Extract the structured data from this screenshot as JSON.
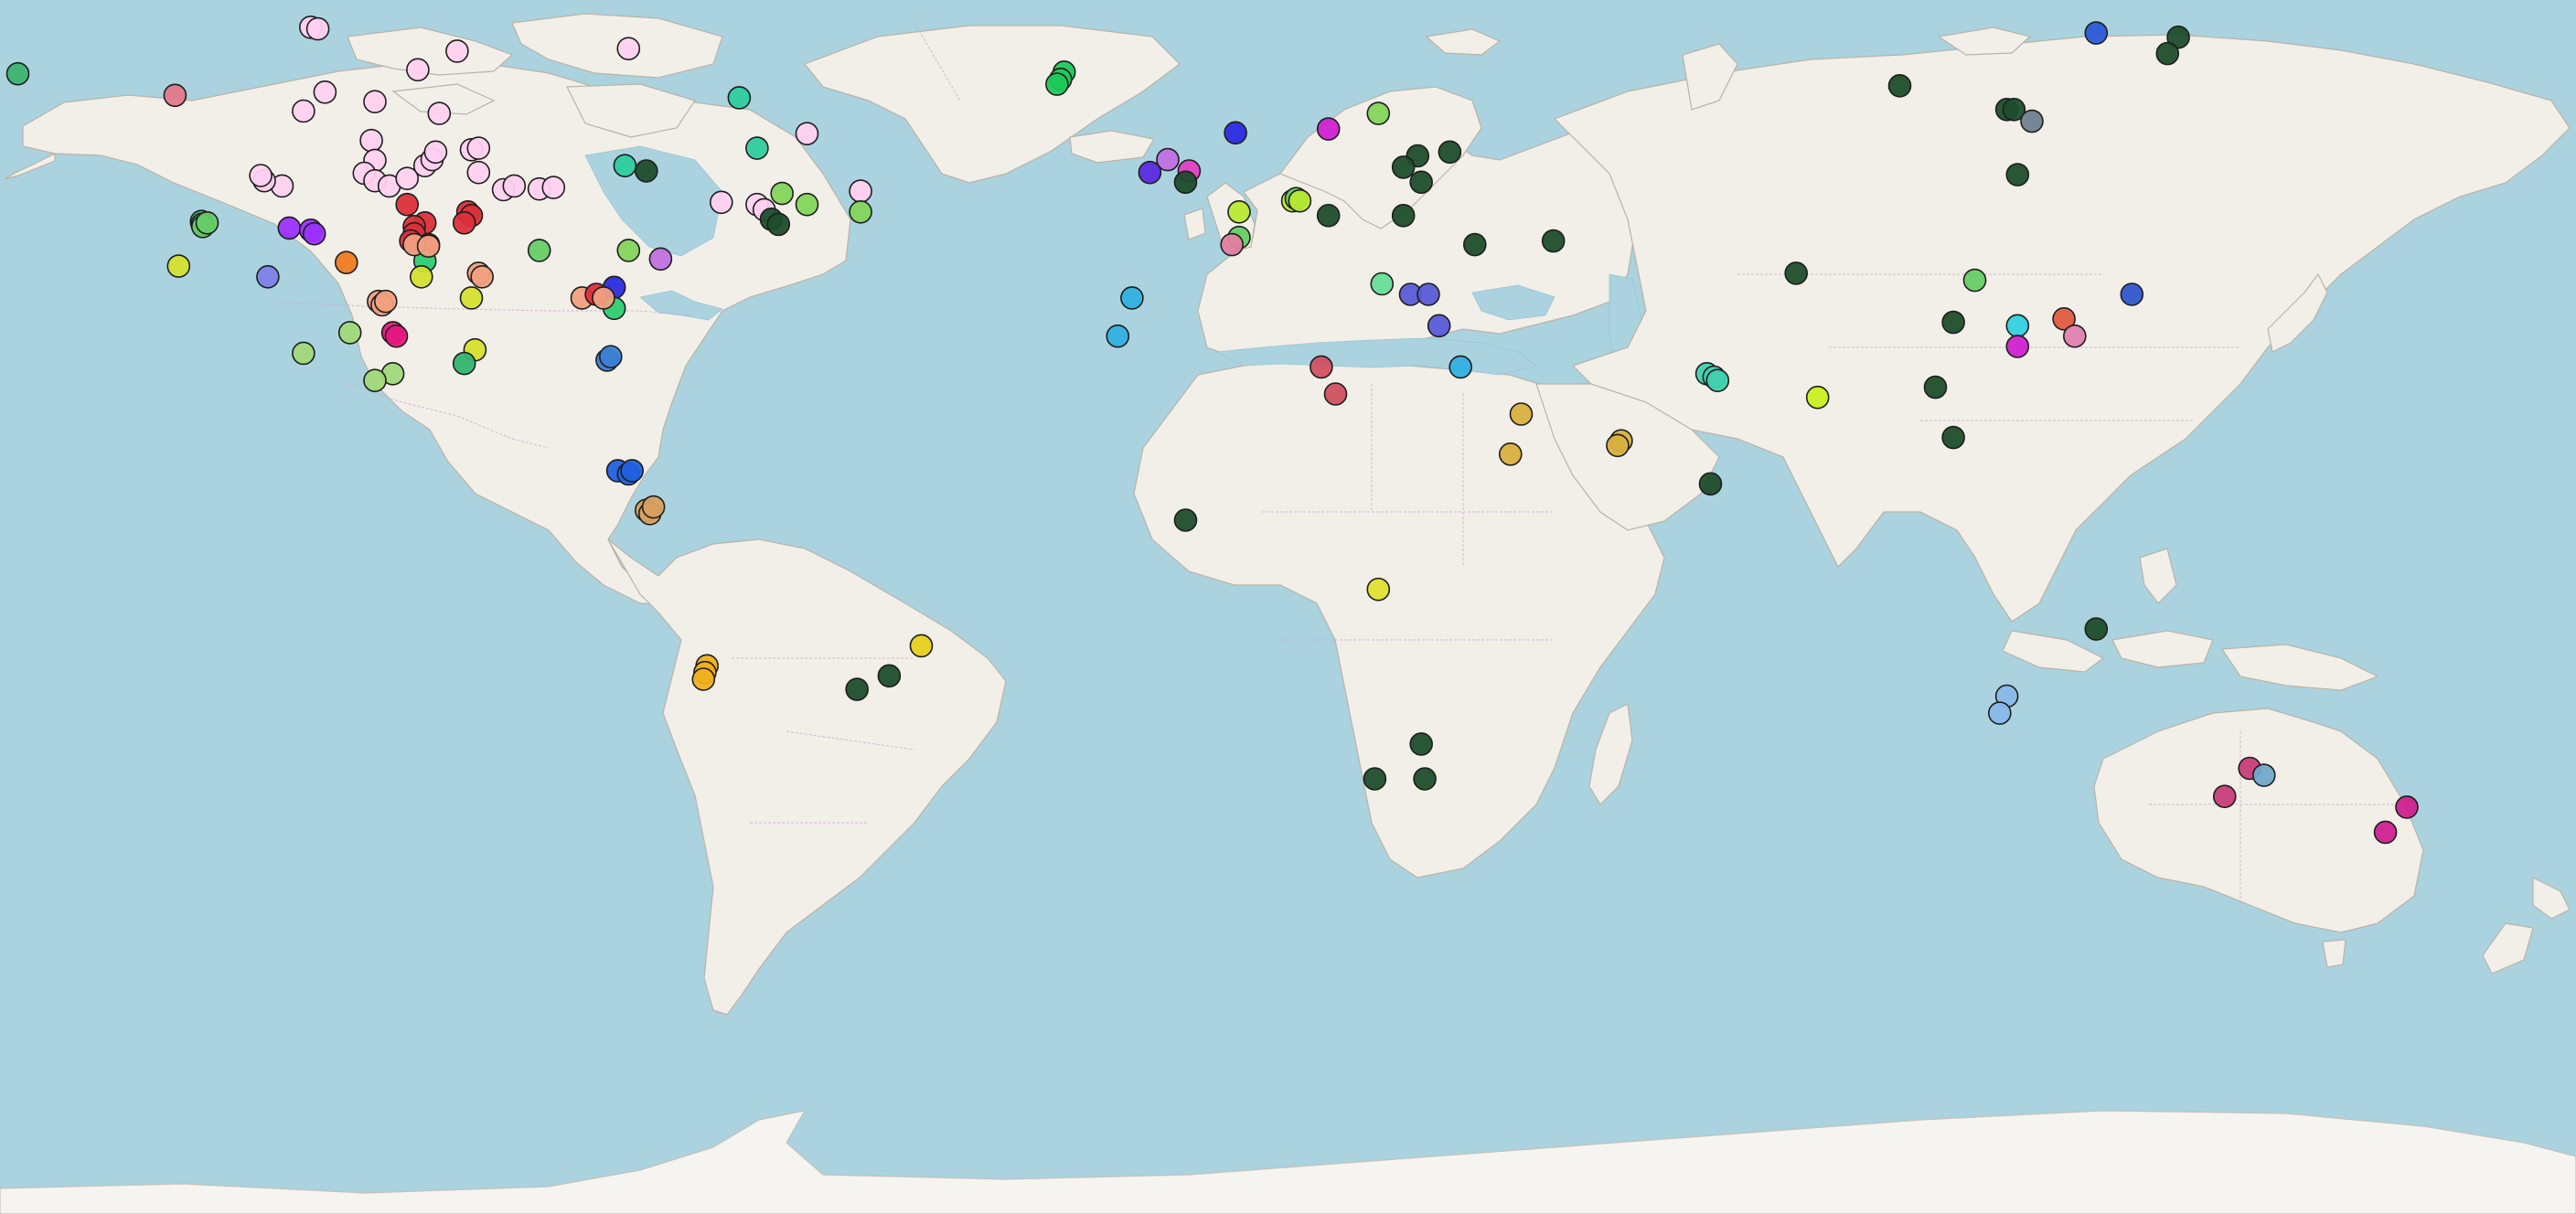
{
  "map": {
    "marker_count": 177
  },
  "markers": [
    {
      "lon": -166.0,
      "lat": 65.5,
      "color": "#3cb371"
    },
    {
      "lon": -144.0,
      "lat": 62.8,
      "color": "#e0788a"
    },
    {
      "lon": -109.0,
      "lat": 78.8,
      "color": "#ffd0f0"
    },
    {
      "lon": -94.5,
      "lat": 78.5,
      "color": "#ffd0f0"
    },
    {
      "lon": -83.5,
      "lat": 76.2,
      "color": "#ffd0f0"
    },
    {
      "lon": -125.0,
      "lat": 71.2,
      "color": "#ffd0f0"
    },
    {
      "lon": -124.0,
      "lat": 71.0,
      "color": "#ffd0f0"
    },
    {
      "lon": -110.0,
      "lat": 66.0,
      "color": "#ffd0f0"
    },
    {
      "lon": -123.0,
      "lat": 63.2,
      "color": "#ffd0f0"
    },
    {
      "lon": -126.0,
      "lat": 60.8,
      "color": "#ffd0f0"
    },
    {
      "lon": -116.0,
      "lat": 62.0,
      "color": "#ffd0f0"
    },
    {
      "lon": -107.0,
      "lat": 60.5,
      "color": "#ffd0f0"
    },
    {
      "lon": -116.5,
      "lat": 57.0,
      "color": "#ffd0f0"
    },
    {
      "lon": -116.0,
      "lat": 54.4,
      "color": "#ffd0f0"
    },
    {
      "lon": -117.5,
      "lat": 52.7,
      "color": "#ffd0f0"
    },
    {
      "lon": -116.0,
      "lat": 51.7,
      "color": "#ffd0f0"
    },
    {
      "lon": -114.0,
      "lat": 51.0,
      "color": "#ffd0f0"
    },
    {
      "lon": -111.5,
      "lat": 52.0,
      "color": "#ffd0f0"
    },
    {
      "lon": -109.0,
      "lat": 53.7,
      "color": "#ffd0f0"
    },
    {
      "lon": -108.0,
      "lat": 54.5,
      "color": "#ffd0f0"
    },
    {
      "lon": -107.5,
      "lat": 55.5,
      "color": "#ffd0f0"
    },
    {
      "lon": -102.5,
      "lat": 55.8,
      "color": "#ffd0f0"
    },
    {
      "lon": -101.5,
      "lat": 56.0,
      "color": "#ffd0f0"
    },
    {
      "lon": -101.5,
      "lat": 52.8,
      "color": "#ffd0f0"
    },
    {
      "lon": -98.0,
      "lat": 50.5,
      "color": "#ffd0f0"
    },
    {
      "lon": -96.5,
      "lat": 51.0,
      "color": "#ffd0f0"
    },
    {
      "lon": -93.0,
      "lat": 50.6,
      "color": "#ffd0f0"
    },
    {
      "lon": -91.0,
      "lat": 50.8,
      "color": "#ffd0f0"
    },
    {
      "lon": -129.0,
      "lat": 51.0,
      "color": "#ffd0f0"
    },
    {
      "lon": -131.5,
      "lat": 51.7,
      "color": "#ffd0f0"
    },
    {
      "lon": -132.0,
      "lat": 52.4,
      "color": "#ffd0f0"
    },
    {
      "lon": -104.5,
      "lat": 68.3,
      "color": "#ffd0f0"
    },
    {
      "lon": -80.5,
      "lat": 68.6,
      "color": "#ffd0f0"
    },
    {
      "lon": -55.5,
      "lat": 57.9,
      "color": "#ffd0f0"
    },
    {
      "lon": -48.0,
      "lat": 50.3,
      "color": "#ffd0f0"
    },
    {
      "lon": -67.5,
      "lat": 48.8,
      "color": "#ffd0f0"
    },
    {
      "lon": -62.5,
      "lat": 48.5,
      "color": "#ffd0f0"
    },
    {
      "lon": -61.5,
      "lat": 47.8,
      "color": "#ffd0f0"
    },
    {
      "lon": -81.0,
      "lat": 53.7,
      "color": "#2ecc9e"
    },
    {
      "lon": -78.0,
      "lat": 53.0,
      "color": "#1e4d2b"
    },
    {
      "lon": -62.5,
      "lat": 56.0,
      "color": "#2ecc9e"
    },
    {
      "lon": -65.0,
      "lat": 62.5,
      "color": "#2ecc9e"
    },
    {
      "lon": -59.0,
      "lat": 50.0,
      "color": "#84d45c"
    },
    {
      "lon": -55.5,
      "lat": 48.5,
      "color": "#84d45c"
    },
    {
      "lon": -48.0,
      "lat": 47.5,
      "color": "#84d45c"
    },
    {
      "lon": -60.5,
      "lat": 46.5,
      "color": "#1e4d2b"
    },
    {
      "lon": -59.5,
      "lat": 45.8,
      "color": "#1e4d2b"
    },
    {
      "lon": -80.5,
      "lat": 42.2,
      "color": "#84d45c"
    },
    {
      "lon": -140.3,
      "lat": 46.2,
      "color": "#3cb371"
    },
    {
      "lon": -140.2,
      "lat": 45.8,
      "color": "#3cb371"
    },
    {
      "lon": -140.1,
      "lat": 45.5,
      "color": "#66cc66"
    },
    {
      "lon": -139.5,
      "lat": 46.0,
      "color": "#66cc66"
    },
    {
      "lon": -143.5,
      "lat": 40.0,
      "color": "#d4e030"
    },
    {
      "lon": -128.0,
      "lat": 45.3,
      "color": "#9b30ff"
    },
    {
      "lon": -125.0,
      "lat": 45.0,
      "color": "#9b30ff"
    },
    {
      "lon": -124.5,
      "lat": 44.5,
      "color": "#9b30ff"
    },
    {
      "lon": -131.0,
      "lat": 38.5,
      "color": "#8080e8"
    },
    {
      "lon": -120.0,
      "lat": 40.5,
      "color": "#f07a20"
    },
    {
      "lon": -111.5,
      "lat": 48.5,
      "color": "#dc2f3a"
    },
    {
      "lon": -109.0,
      "lat": 46.0,
      "color": "#dc2f3a"
    },
    {
      "lon": -110.5,
      "lat": 45.5,
      "color": "#dc2f3a"
    },
    {
      "lon": -110.5,
      "lat": 44.5,
      "color": "#dc2f3a"
    },
    {
      "lon": -111.0,
      "lat": 43.5,
      "color": "#dc2f3a"
    },
    {
      "lon": -108.5,
      "lat": 43.0,
      "color": "#dc2f3a"
    },
    {
      "lon": -103.0,
      "lat": 47.5,
      "color": "#dc2f3a"
    },
    {
      "lon": -102.5,
      "lat": 47.0,
      "color": "#dc2f3a"
    },
    {
      "lon": -103.5,
      "lat": 46.0,
      "color": "#dc2f3a"
    },
    {
      "lon": -109.0,
      "lat": 40.7,
      "color": "#2ecc71"
    },
    {
      "lon": -110.5,
      "lat": 43.0,
      "color": "#f0a080"
    },
    {
      "lon": -108.5,
      "lat": 42.8,
      "color": "#f0a080"
    },
    {
      "lon": -109.5,
      "lat": 38.5,
      "color": "#d4e030"
    },
    {
      "lon": -101.5,
      "lat": 39.0,
      "color": "#f0a080"
    },
    {
      "lon": -101.0,
      "lat": 38.5,
      "color": "#f0a080"
    },
    {
      "lon": -115.5,
      "lat": 35.0,
      "color": "#f0a080"
    },
    {
      "lon": -115.0,
      "lat": 34.5,
      "color": "#f0a080"
    },
    {
      "lon": -114.5,
      "lat": 35.0,
      "color": "#f0a080"
    },
    {
      "lon": -102.5,
      "lat": 35.5,
      "color": "#d4e030"
    },
    {
      "lon": -113.5,
      "lat": 30.5,
      "color": "#e6177f"
    },
    {
      "lon": -113.0,
      "lat": 30.0,
      "color": "#e6177f"
    },
    {
      "lon": -119.5,
      "lat": 30.5,
      "color": "#a0d87a"
    },
    {
      "lon": -102.0,
      "lat": 28.0,
      "color": "#d4e030"
    },
    {
      "lon": -126.0,
      "lat": 27.5,
      "color": "#a0d87a"
    },
    {
      "lon": -113.5,
      "lat": 24.5,
      "color": "#a0d87a"
    },
    {
      "lon": -116.0,
      "lat": 23.5,
      "color": "#a0d87a"
    },
    {
      "lon": -103.5,
      "lat": 26.0,
      "color": "#32b46e"
    },
    {
      "lon": -93.0,
      "lat": 42.2,
      "color": "#66cc66"
    },
    {
      "lon": -87.0,
      "lat": 35.5,
      "color": "#f0a080"
    },
    {
      "lon": -85.0,
      "lat": 36.0,
      "color": "#dc2f3a"
    },
    {
      "lon": -82.5,
      "lat": 37.0,
      "color": "#2b2be0"
    },
    {
      "lon": -82.5,
      "lat": 34.0,
      "color": "#2ecc71"
    },
    {
      "lon": -84.0,
      "lat": 35.5,
      "color": "#f0a080"
    },
    {
      "lon": -76.0,
      "lat": 41.0,
      "color": "#c070e0"
    },
    {
      "lon": -83.5,
      "lat": 26.5,
      "color": "#3a7fd5"
    },
    {
      "lon": -83.0,
      "lat": 27.0,
      "color": "#3a7fd5"
    },
    {
      "lon": -82.0,
      "lat": 10.0,
      "color": "#2060e0"
    },
    {
      "lon": -80.5,
      "lat": 9.5,
      "color": "#2060e0"
    },
    {
      "lon": -80.0,
      "lat": 10.0,
      "color": "#2060e0"
    },
    {
      "lon": -78.0,
      "lat": 4.0,
      "color": "#d8a060"
    },
    {
      "lon": -77.5,
      "lat": 3.5,
      "color": "#d8a060"
    },
    {
      "lon": -77.0,
      "lat": 4.5,
      "color": "#d8a060"
    },
    {
      "lon": -69.5,
      "lat": -19.5,
      "color": "#f0b020"
    },
    {
      "lon": -69.8,
      "lat": -20.5,
      "color": "#f0b020"
    },
    {
      "lon": -70.0,
      "lat": -21.5,
      "color": "#f0b020"
    },
    {
      "lon": -48.5,
      "lat": -23.0,
      "color": "#1e4d2b"
    },
    {
      "lon": -44.0,
      "lat": -21.0,
      "color": "#1e4d2b"
    },
    {
      "lon": -39.5,
      "lat": -16.5,
      "color": "#e6d020"
    },
    {
      "lon": -19.5,
      "lat": 65.7,
      "color": "#1ec85a"
    },
    {
      "lon": -20.0,
      "lat": 64.8,
      "color": "#1ec85a"
    },
    {
      "lon": -20.5,
      "lat": 64.2,
      "color": "#1ec85a"
    },
    {
      "lon": -7.5,
      "lat": 52.8,
      "color": "#5a2be0"
    },
    {
      "lon": -5.0,
      "lat": 54.5,
      "color": "#c070e0"
    },
    {
      "lon": -2.0,
      "lat": 53.0,
      "color": "#e040c0"
    },
    {
      "lon": -2.5,
      "lat": 51.5,
      "color": "#1e4d2b"
    },
    {
      "lon": 4.5,
      "lat": 58.0,
      "color": "#2b2be0"
    },
    {
      "lon": 5.0,
      "lat": 47.5,
      "color": "#b8e830"
    },
    {
      "lon": 5.0,
      "lat": 44.0,
      "color": "#66cc66"
    },
    {
      "lon": 4.0,
      "lat": 43.0,
      "color": "#e080a0"
    },
    {
      "lon": 12.5,
      "lat": 49.0,
      "color": "#b8e830"
    },
    {
      "lon": 13.0,
      "lat": 49.3,
      "color": "#66cc66"
    },
    {
      "lon": 13.5,
      "lat": 49.0,
      "color": "#b8e830"
    },
    {
      "lon": -10.0,
      "lat": 35.5,
      "color": "#30b0e0"
    },
    {
      "lon": -12.0,
      "lat": 30.0,
      "color": "#30b0e0"
    },
    {
      "lon": 17.5,
      "lat": 58.5,
      "color": "#d020d0"
    },
    {
      "lon": 24.5,
      "lat": 60.5,
      "color": "#84d45c"
    },
    {
      "lon": 17.5,
      "lat": 47.0,
      "color": "#1e4d2b"
    },
    {
      "lon": 28.0,
      "lat": 47.0,
      "color": "#1e4d2b"
    },
    {
      "lon": 25.0,
      "lat": 37.5,
      "color": "#66dd99"
    },
    {
      "lon": 29.0,
      "lat": 36.0,
      "color": "#5a5ad8"
    },
    {
      "lon": 31.5,
      "lat": 36.0,
      "color": "#5a5ad8"
    },
    {
      "lon": 33.0,
      "lat": 31.5,
      "color": "#5a5ad8"
    },
    {
      "lon": 16.5,
      "lat": 25.5,
      "color": "#d05060"
    },
    {
      "lon": 18.5,
      "lat": 21.5,
      "color": "#d05060"
    },
    {
      "lon": 36.0,
      "lat": 25.5,
      "color": "#30b0e0"
    },
    {
      "lon": 44.5,
      "lat": 18.5,
      "color": "#d8b040"
    },
    {
      "lon": 43.0,
      "lat": 12.5,
      "color": "#d8b040"
    },
    {
      "lon": 58.5,
      "lat": 14.5,
      "color": "#d8b040"
    },
    {
      "lon": 58.0,
      "lat": 13.8,
      "color": "#d8b040"
    },
    {
      "lon": 24.5,
      "lat": -8.0,
      "color": "#e0e030"
    },
    {
      "lon": -2.5,
      "lat": 2.5,
      "color": "#1e4d2b"
    },
    {
      "lon": 24.0,
      "lat": -36.0,
      "color": "#1e4d2b"
    },
    {
      "lon": 30.5,
      "lat": -31.0,
      "color": "#1e4d2b"
    },
    {
      "lon": 31.0,
      "lat": -36.0,
      "color": "#1e4d2b"
    },
    {
      "lon": 30.0,
      "lat": 55.0,
      "color": "#1e4d2b"
    },
    {
      "lon": 28.0,
      "lat": 53.5,
      "color": "#1e4d2b"
    },
    {
      "lon": 30.5,
      "lat": 51.5,
      "color": "#1e4d2b"
    },
    {
      "lon": 34.5,
      "lat": 55.5,
      "color": "#1e4d2b"
    },
    {
      "lon": 38.0,
      "lat": 43.0,
      "color": "#1e4d2b"
    },
    {
      "lon": 49.0,
      "lat": 43.5,
      "color": "#1e4d2b"
    },
    {
      "lon": 83.0,
      "lat": 39.0,
      "color": "#1e4d2b"
    },
    {
      "lon": 70.5,
      "lat": 24.5,
      "color": "#40d0b0"
    },
    {
      "lon": 71.5,
      "lat": 24.0,
      "color": "#40d0b0"
    },
    {
      "lon": 72.0,
      "lat": 23.5,
      "color": "#40d0b0"
    },
    {
      "lon": 86.0,
      "lat": 21.0,
      "color": "#c8f020"
    },
    {
      "lon": 71.0,
      "lat": 8.0,
      "color": "#1e4d2b"
    },
    {
      "lon": 102.5,
      "lat": 22.5,
      "color": "#1e4d2b"
    },
    {
      "lon": 105.0,
      "lat": 15.0,
      "color": "#1e4d2b"
    },
    {
      "lon": 108.0,
      "lat": 38.0,
      "color": "#66cc66"
    },
    {
      "lon": 105.0,
      "lat": 32.0,
      "color": "#1e4d2b"
    },
    {
      "lon": 114.0,
      "lat": 31.5,
      "color": "#30d0e0"
    },
    {
      "lon": 114.0,
      "lat": 28.5,
      "color": "#d020d0"
    },
    {
      "lon": 120.5,
      "lat": 32.5,
      "color": "#e05a40"
    },
    {
      "lon": 122.0,
      "lat": 30.0,
      "color": "#e080b0"
    },
    {
      "lon": 130.0,
      "lat": 36.0,
      "color": "#3055d0"
    },
    {
      "lon": 97.5,
      "lat": 64.0,
      "color": "#1e4d2b"
    },
    {
      "lon": 112.5,
      "lat": 61.0,
      "color": "#1e4d2b"
    },
    {
      "lon": 113.5,
      "lat": 61.0,
      "color": "#1e4d2b"
    },
    {
      "lon": 116.0,
      "lat": 59.5,
      "color": "#708090"
    },
    {
      "lon": 136.5,
      "lat": 70.0,
      "color": "#1e4d2b"
    },
    {
      "lon": 135.0,
      "lat": 68.0,
      "color": "#1e4d2b"
    },
    {
      "lon": 125.0,
      "lat": 70.5,
      "color": "#2a5ad8"
    },
    {
      "lon": 114.0,
      "lat": 52.5,
      "color": "#1e4d2b"
    },
    {
      "lon": 125.0,
      "lat": -14.0,
      "color": "#1e4d2b"
    },
    {
      "lon": 112.5,
      "lat": -24.0,
      "color": "#88b8e8"
    },
    {
      "lon": 111.5,
      "lat": -26.5,
      "color": "#88b8e8"
    },
    {
      "lon": 146.5,
      "lat": -34.5,
      "color": "#c83c7a"
    },
    {
      "lon": 148.5,
      "lat": -35.5,
      "color": "#70a8c8"
    },
    {
      "lon": 143.0,
      "lat": -38.5,
      "color": "#c83c7a"
    },
    {
      "lon": 168.5,
      "lat": -40.0,
      "color": "#d02090"
    },
    {
      "lon": 165.5,
      "lat": -43.5,
      "color": "#d02090"
    }
  ]
}
